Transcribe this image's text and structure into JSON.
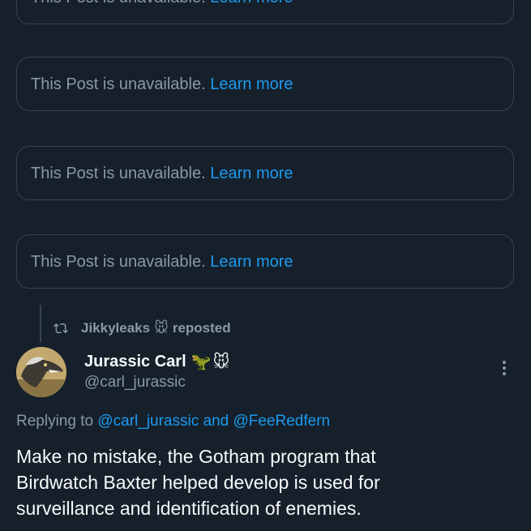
{
  "unavailable_posts": [
    {
      "text": "This Post is unavailable.",
      "link": "Learn more"
    },
    {
      "text": "This Post is unavailable.",
      "link": "Learn more"
    },
    {
      "text": "This Post is unavailable.",
      "link": "Learn more"
    },
    {
      "text": "This Post is unavailable.",
      "link": "Learn more"
    }
  ],
  "repost": {
    "icon": "repost-icon",
    "user": "Jikkyleaks",
    "emoji": "🐭",
    "action": "reposted"
  },
  "post": {
    "author": {
      "display_name": "Jurassic Carl",
      "emojis": [
        "🦖",
        "🐭"
      ],
      "handle": "@carl_jurassic",
      "avatar_icon": "dinosaur-avatar"
    },
    "more_icon": "more-vertical-icon",
    "replying_to": {
      "prefix": "Replying to",
      "mention1": "@carl_jurassic",
      "conjunction": "and",
      "mention2": "@FeeRedfern"
    },
    "body_lines": [
      "Make no mistake, the Gotham program that",
      "Birdwatch Baxter helped develop is used for",
      "surveillance and identification of enemies."
    ]
  },
  "colors": {
    "background": "#15202b",
    "border": "#38444d",
    "secondary_text": "#8b98a5",
    "primary_text": "#f7f9f9",
    "link": "#1d9bf0"
  }
}
